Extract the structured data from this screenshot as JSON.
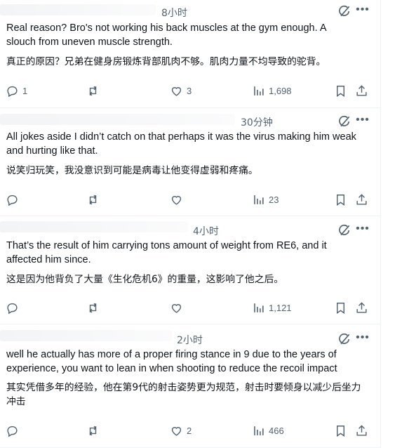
{
  "replies": [
    {
      "time": "8小时",
      "text_en": "Real reason? Bro's not working his back muscles at the gym enough. A slouch from uneven muscle strength.",
      "text_zh": "真正的原因？兄弟在健身房锻炼背部肌肉不够。肌肉力量不均导致的驼背。",
      "replies_count": "1",
      "likes": "3",
      "views": "1,698"
    },
    {
      "time": "30分钟",
      "text_en": "All jokes aside I didn’t catch on that perhaps it was the virus making him weak and hurting like that.",
      "text_zh": "说笑归玩笑，我没意识到可能是病毒让他变得虚弱和疼痛。",
      "replies_count": "",
      "likes": "",
      "views": "23"
    },
    {
      "time": "4小时",
      "text_en": "That’s the result of him carrying tons amount of weight from RE6, and it affected him since.",
      "text_zh": "这是因为他背负了大量《生化危机6》的重量，这影响了他之后。",
      "replies_count": "",
      "likes": "",
      "views": "1,121"
    },
    {
      "time": "2小时",
      "text_en": "well he actually has more of a proper firing stance in 9 due to the years of experience, you want to lean in when shooting to reduce the recoil impact",
      "text_zh": "其实凭借多年的经验，他在第9代的射击姿势更为规范，射击时要倾身以减少后坐力冲击",
      "replies_count": "",
      "likes": "2",
      "views": "466"
    }
  ],
  "icons": {
    "grok": "grok-icon",
    "more": "more-icon",
    "reply": "reply-icon",
    "repost": "repost-icon",
    "like": "heart-icon",
    "views": "views-icon",
    "bookmark": "bookmark-icon",
    "share": "share-icon"
  },
  "colors": {
    "text": "#0f1419",
    "muted": "#536471",
    "divider": "#eff3f4"
  }
}
